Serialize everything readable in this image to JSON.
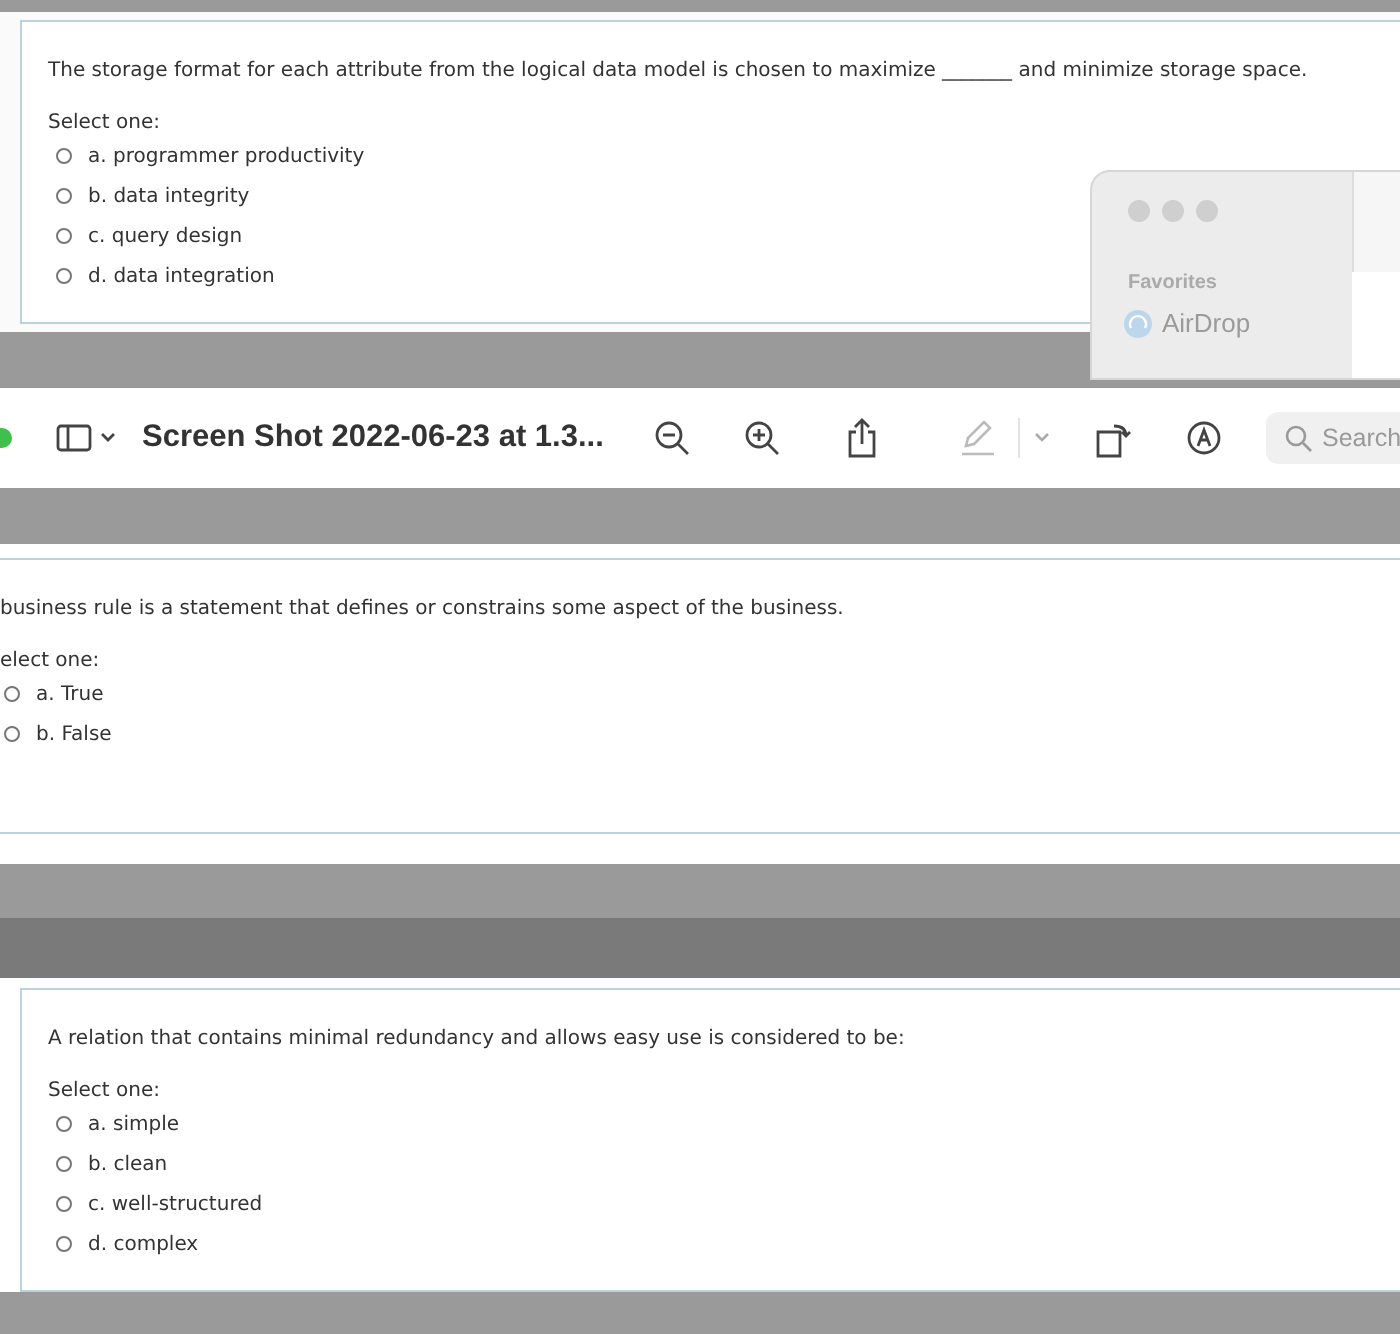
{
  "questions": [
    {
      "kind": "full",
      "prompt": "The storage format for each attribute from the logical data model is chosen to maximize _______ and minimize storage space.",
      "select_label": "Select one:",
      "options": [
        {
          "label": "a. programmer productivity",
          "selected": false
        },
        {
          "label": "b. data integrity",
          "selected": false
        },
        {
          "label": "c. query design",
          "selected": false
        },
        {
          "label": "d. data integration",
          "selected": false
        }
      ]
    },
    {
      "kind": "cropped",
      "prompt": "business rule is a statement that defines or constrains some aspect of the business.",
      "select_label": "elect one:",
      "options": [
        {
          "label": "a. True",
          "selected": false
        },
        {
          "label": "b. False",
          "selected": false
        }
      ]
    },
    {
      "kind": "full",
      "prompt": "A relation that contains minimal redundancy and allows easy use is considered to be:",
      "select_label": "Select one:",
      "options": [
        {
          "label": "a. simple",
          "selected": false
        },
        {
          "label": "b. clean",
          "selected": false
        },
        {
          "label": "c. well-structured",
          "selected": false
        },
        {
          "label": "d. complex",
          "selected": false
        }
      ]
    }
  ],
  "toolbar": {
    "title": "Screen Shot 2022-06-23 at 1.3...",
    "search": {
      "placeholder": "Search"
    }
  },
  "finder": {
    "section": "Favorites",
    "items": [
      {
        "label": "AirDrop"
      }
    ]
  }
}
